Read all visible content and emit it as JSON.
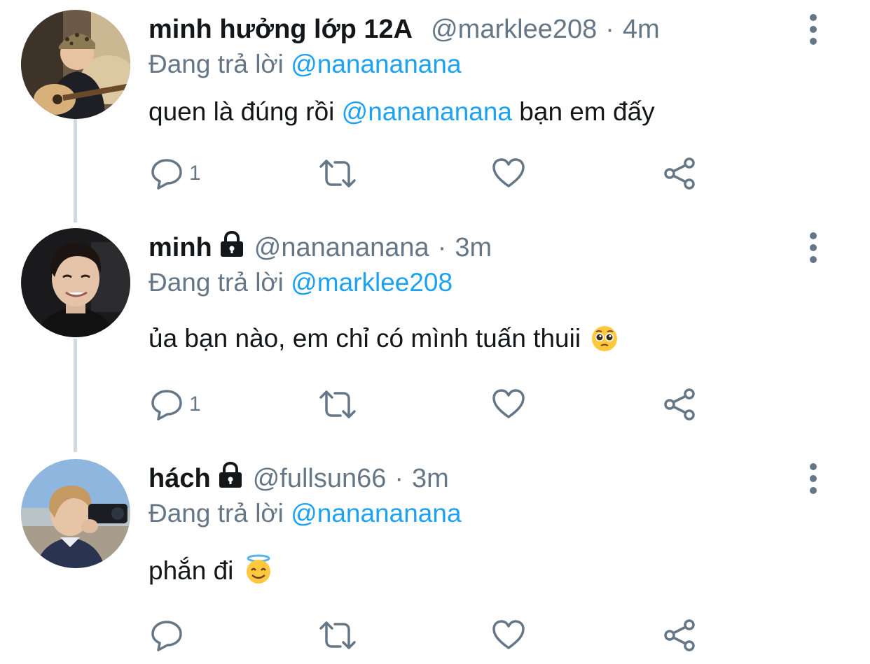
{
  "tweets": [
    {
      "name": "minh hưởng lớp 12A",
      "protected": false,
      "handle": "@marklee208",
      "time": "4m",
      "replying_prefix": "Đang trả lời",
      "replying_to": "@nanananana",
      "body_before": "quen là đúng rồi ",
      "body_mention": "@nanananana",
      "body_after": " bạn em đấy",
      "reply_count": "1",
      "avatar_icon": "person-with-guitar-avatar"
    },
    {
      "name": "minh",
      "protected": true,
      "handle": "@nanananana",
      "time": "3m",
      "replying_prefix": "Đang trả lời",
      "replying_to": "@marklee208",
      "body_before": "ủa bạn nào, em chỉ có mình tuấn thuii",
      "body_mention": "",
      "body_after": "",
      "emoji": "pleading-face",
      "reply_count": "1",
      "avatar_icon": "smiling-person-avatar"
    },
    {
      "name": "hách",
      "protected": true,
      "handle": "@fullsun66",
      "time": "3m",
      "replying_prefix": "Đang trả lời",
      "replying_to": "@nanananana",
      "body_before": "phắn đi",
      "body_mention": "",
      "body_after": "",
      "emoji": "smiling-face-with-halo",
      "reply_count": "",
      "avatar_icon": "person-with-camera-avatar"
    }
  ],
  "colors": {
    "link": "#1da1f2",
    "secondary": "#657786",
    "thread_line": "#cfd9de"
  }
}
